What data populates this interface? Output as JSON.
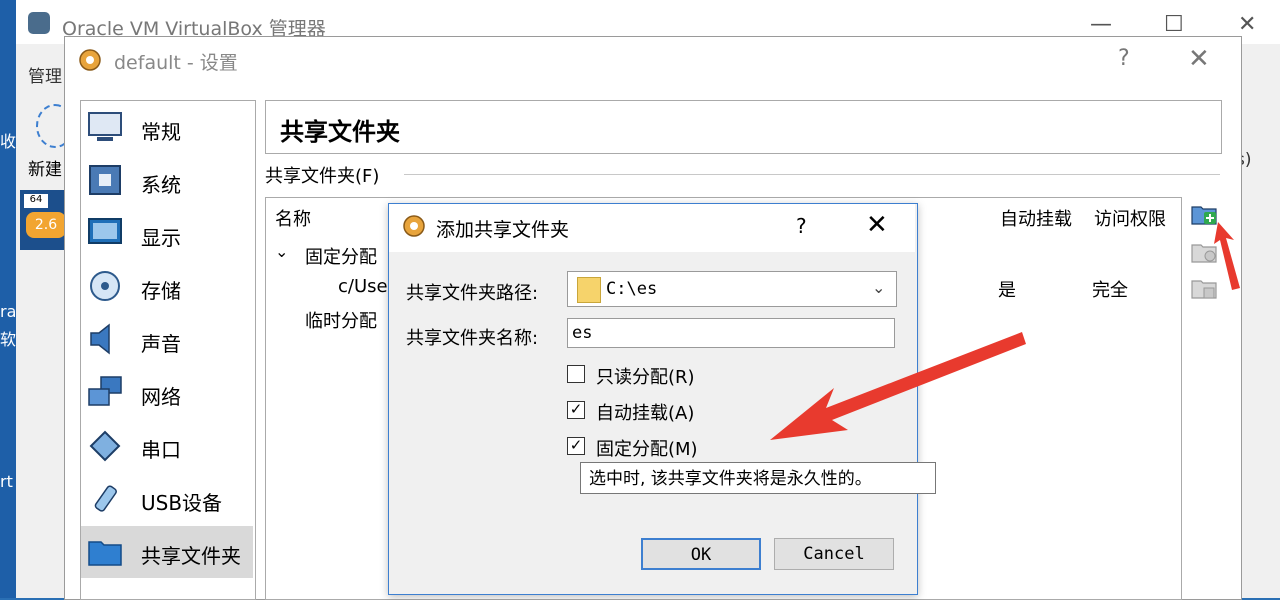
{
  "manager": {
    "title": "Oracle VM VirtualBox 管理器",
    "menu_fragment": "管理",
    "new_fragment": "新建",
    "vm_badge": "64",
    "vm_version": "2.6",
    "left_edge_texts": [
      "收",
      "ra",
      "软",
      "rt"
    ],
    "right_fragment": "s)"
  },
  "settings": {
    "title": "default - 设置",
    "help": "?",
    "close": "✕",
    "nav": [
      {
        "label": "常规",
        "icon": "monitor-icon"
      },
      {
        "label": "系统",
        "icon": "chip-icon"
      },
      {
        "label": "显示",
        "icon": "display-icon"
      },
      {
        "label": "存储",
        "icon": "disk-icon"
      },
      {
        "label": "声音",
        "icon": "speaker-icon"
      },
      {
        "label": "网络",
        "icon": "network-icon"
      },
      {
        "label": "串口",
        "icon": "serial-icon"
      },
      {
        "label": "USB设备",
        "icon": "usb-icon"
      },
      {
        "label": "共享文件夹",
        "icon": "folder-icon"
      }
    ],
    "page_title": "共享文件夹",
    "group_label": "共享文件夹(F)",
    "columns": {
      "name": "名称",
      "automount": "自动挂载",
      "access": "访问权限"
    },
    "tree": {
      "fixed_group": "固定分配",
      "fixed_row_path": "c/Use",
      "fixed_row_automount": "是",
      "fixed_row_access": "完全",
      "temp_group": "临时分配"
    },
    "toolbar": [
      "add-share-icon",
      "edit-share-icon",
      "remove-share-icon"
    ]
  },
  "add_dialog": {
    "title": "添加共享文件夹",
    "help": "?",
    "close": "✕",
    "path_label": "共享文件夹路径:",
    "path_value": "C:\\es",
    "name_label": "共享文件夹名称:",
    "name_value": "es",
    "checkboxes": [
      {
        "label": "只读分配(R)",
        "checked": false
      },
      {
        "label": "自动挂载(A)",
        "checked": true
      },
      {
        "label": "固定分配(M)",
        "checked": true
      }
    ],
    "tooltip": "选中时, 该共享文件夹将是永久性的。",
    "ok_label": "OK",
    "cancel_label": "Cancel"
  },
  "colors": {
    "accent": "#3d7fd0",
    "annotation_arrow": "#e83a2e",
    "selected_nav": "#d9d9d9"
  }
}
